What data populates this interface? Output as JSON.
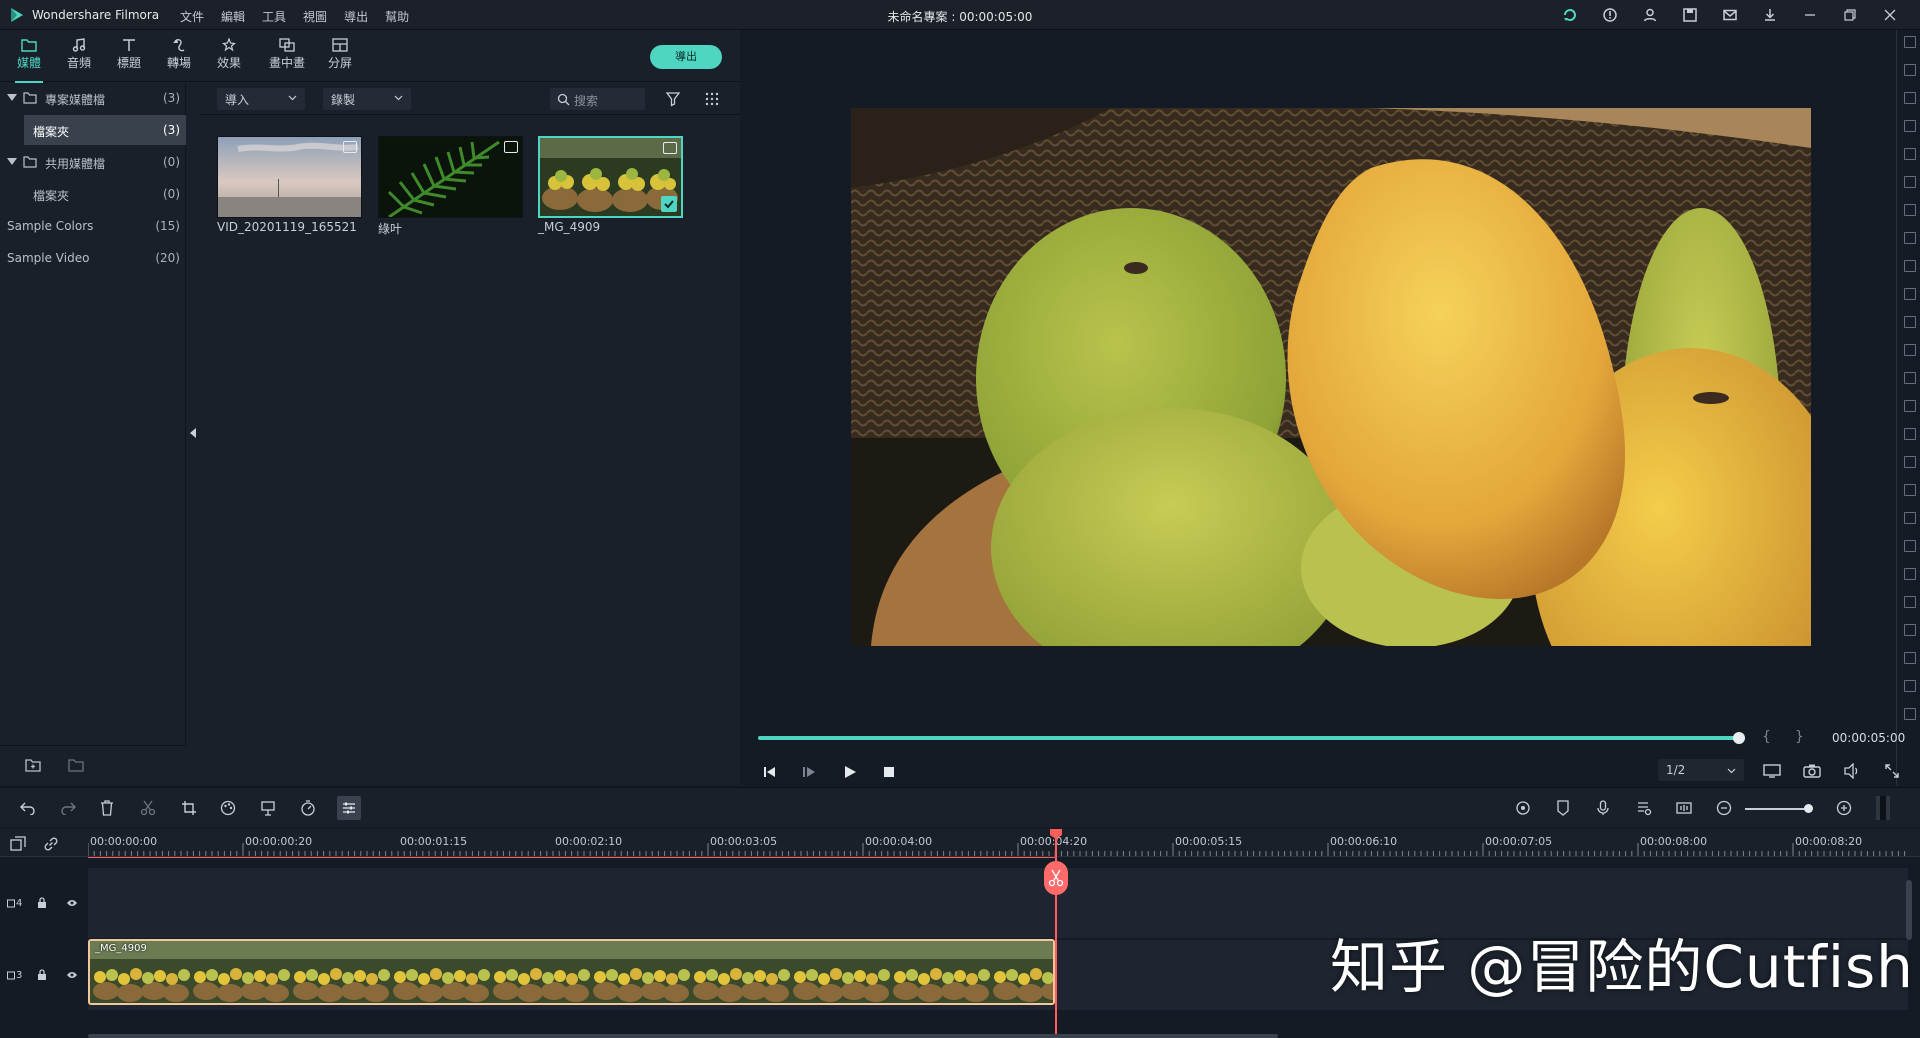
{
  "app": {
    "name": "Wondershare Filmora",
    "project_title": "未命名專案 : 00:00:05:00",
    "menu": [
      "文件",
      "編輯",
      "工具",
      "視圖",
      "導出",
      "幫助"
    ]
  },
  "tabs": [
    {
      "label": "媒體",
      "icon": "folder-icon"
    },
    {
      "label": "音頻",
      "icon": "music-icon"
    },
    {
      "label": "標題",
      "icon": "text-icon"
    },
    {
      "label": "轉場",
      "icon": "transition-icon"
    },
    {
      "label": "效果",
      "icon": "effects-icon"
    },
    {
      "label": "畫中畫",
      "icon": "pip-icon"
    },
    {
      "label": "分屏",
      "icon": "split-screen-icon"
    }
  ],
  "export_label": "導出",
  "tree": [
    {
      "label": "專案媒體檔",
      "count": "(3)"
    },
    {
      "label": "檔案夾",
      "count": "(3)"
    },
    {
      "label": "共用媒體檔",
      "count": "(0)"
    },
    {
      "label": "檔案夾",
      "count": "(0)"
    },
    {
      "label": "Sample Colors",
      "count": "(15)"
    },
    {
      "label": "Sample Video",
      "count": "(20)"
    }
  ],
  "media_toolbar": {
    "import_label": "導入",
    "record_label": "錄製",
    "search_placeholder": "搜索"
  },
  "media": [
    {
      "name": "VID_20201119_165521"
    },
    {
      "name": "綠叶"
    },
    {
      "name": "_MG_4909"
    }
  ],
  "preview": {
    "timecode": "00:00:05:00",
    "ratio": "1/2",
    "progress": 1.0
  },
  "ruler": [
    "00:00:00:00",
    "00:00:00:20",
    "00:00:01:15",
    "00:00:02:10",
    "00:00:03:05",
    "00:00:04:00",
    "00:00:04:20",
    "00:00:05:15",
    "00:00:06:10",
    "00:00:07:05",
    "00:00:08:00",
    "00:00:08:20"
  ],
  "tracks": [
    {
      "label": "4"
    },
    {
      "label": "3"
    }
  ],
  "clip": {
    "name": "_MG_4909"
  },
  "watermark": "知乎 @冒险的Cutfish",
  "colors": {
    "accent": "#4fd6c2",
    "playhead": "#ff5c5c",
    "clip_border": "#f3c79e"
  }
}
